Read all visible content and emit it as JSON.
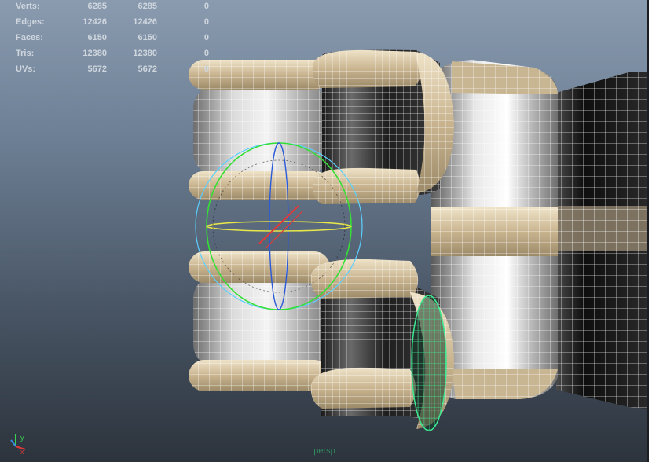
{
  "stats": [
    {
      "label": "Verts:",
      "v1": "6285",
      "v2": "6285",
      "v3": "0"
    },
    {
      "label": "Edges:",
      "v1": "12426",
      "v2": "12426",
      "v3": "0"
    },
    {
      "label": "Faces:",
      "v1": "6150",
      "v2": "6150",
      "v3": "0"
    },
    {
      "label": "Tris:",
      "v1": "12380",
      "v2": "12380",
      "v3": "0"
    },
    {
      "label": "UVs:",
      "v1": "5672",
      "v2": "5672",
      "v3": "0"
    }
  ],
  "camera_label": "persp",
  "axis": {
    "y_label": "y",
    "x_label": "x",
    "y_color": "#39d353",
    "x_color": "#e03a3a",
    "z_color": "#3a8be0"
  },
  "colors": {
    "wire": "#ffffff",
    "tan": "#d8c8a8",
    "selection": "#3de890",
    "manipulator_ring": "#5ad0ff",
    "manipulator_green": "#35e035",
    "manipulator_yellow": "#e8e84a",
    "manipulator_red": "#e03a3a"
  }
}
